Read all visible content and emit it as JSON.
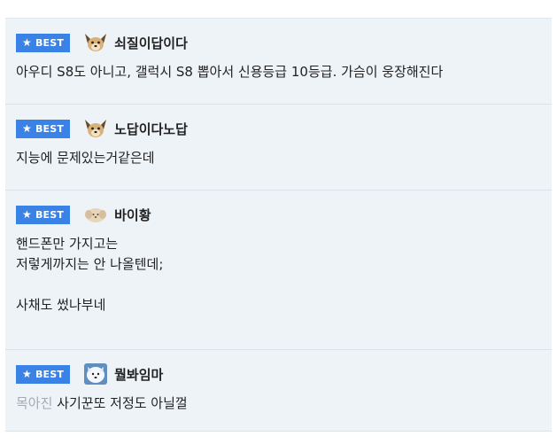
{
  "badge_label": "BEST",
  "comments": [
    {
      "nickname": "쇠질이답이다",
      "avatar": "dog-face-icon",
      "text": "아우디 S8도 아니고, 갤럭시 S8 뽑아서 신용등급 10등급. 가슴이 웅장해진다"
    },
    {
      "nickname": "노답이다노답",
      "avatar": "dog-face-icon",
      "text": "지능에 문제있는거같은데"
    },
    {
      "nickname": "바이황",
      "avatar": "puppy-avatar-icon",
      "text": "핸드폰만 가지고는\n저렇게까지는 안 나올텐데;\n\n사채도 썼나부네"
    },
    {
      "nickname": "뭘봐임마",
      "avatar": "white-dog-avatar-icon",
      "text_prefix": "목아진",
      "text": " 사기꾼또 저정도 아닐껄"
    }
  ],
  "colors": {
    "badge": "#3b82e6",
    "row_background": "#eef3f8",
    "muted_text": "#a6aab0"
  }
}
